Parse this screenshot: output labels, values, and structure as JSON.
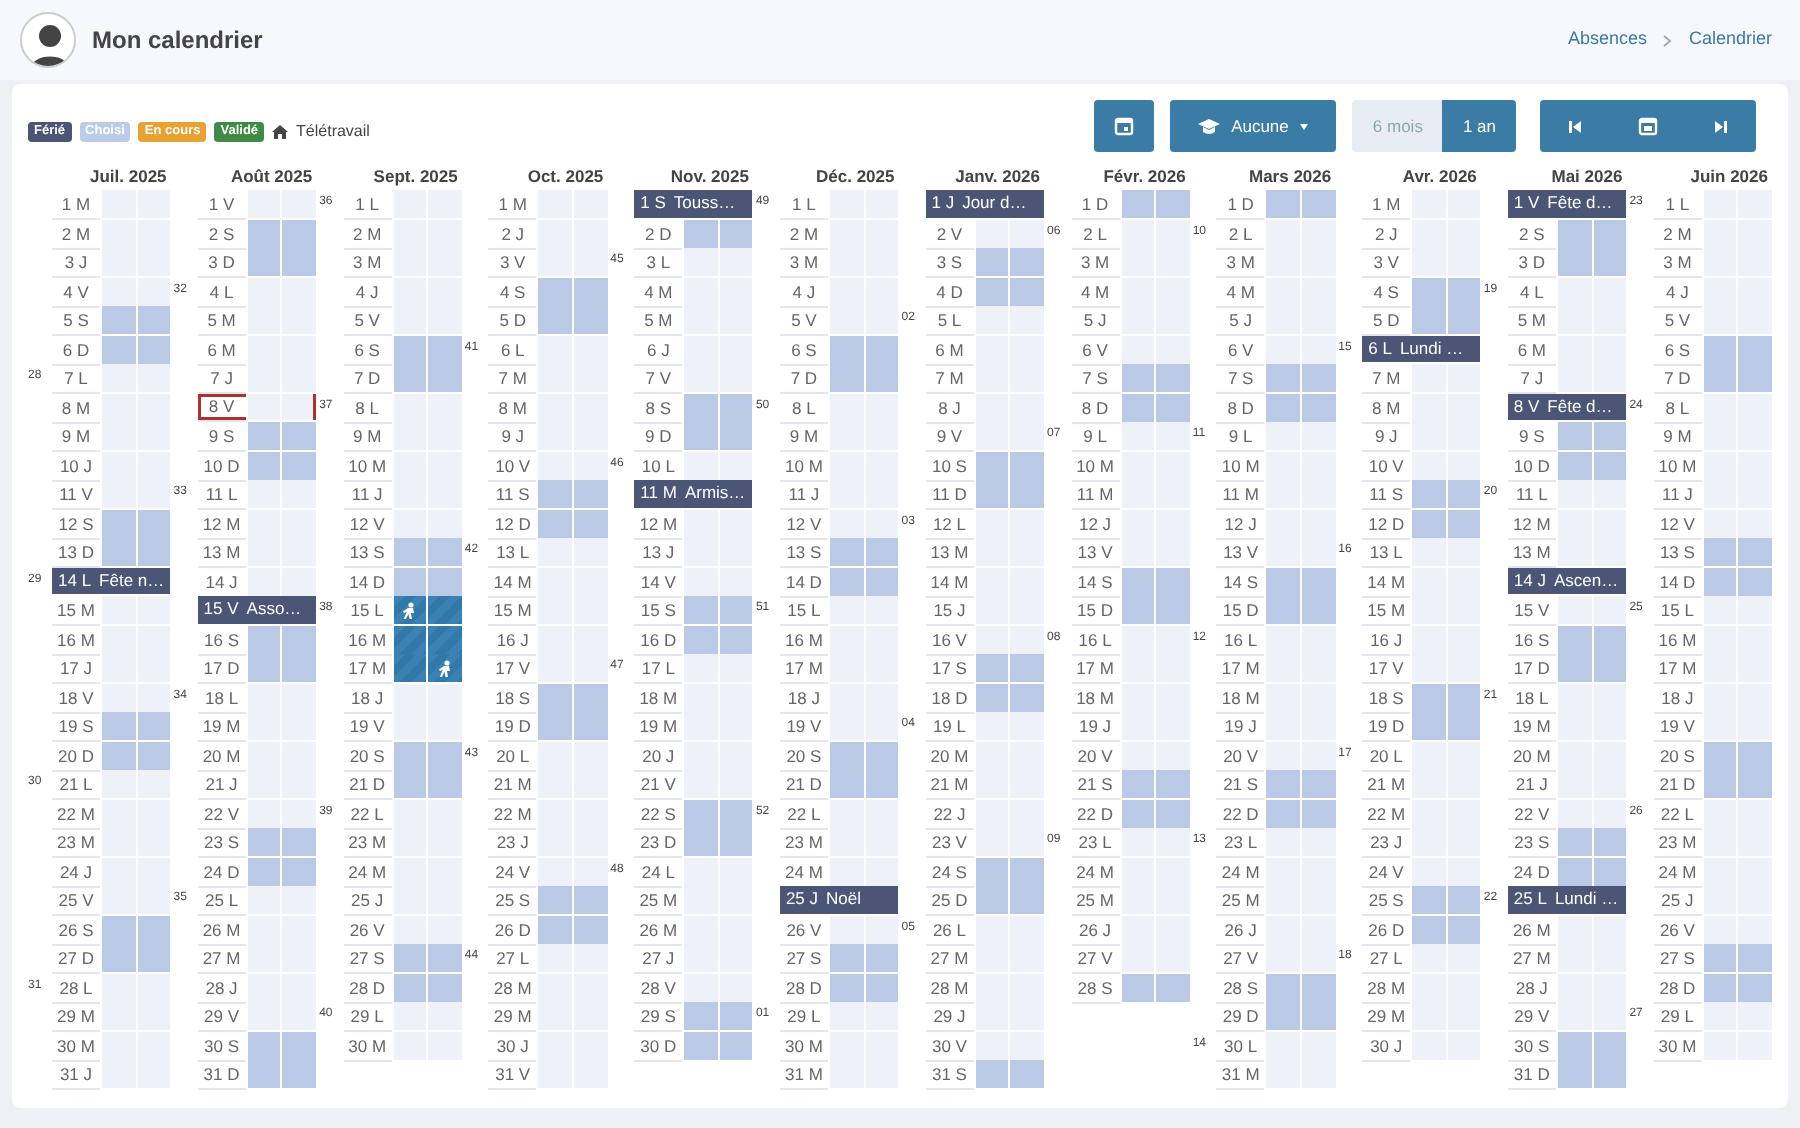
{
  "header": {
    "title": "Mon calendrier",
    "breadcrumb": [
      "Absences",
      "Calendrier"
    ]
  },
  "legend": [
    {
      "label": "Férié",
      "color": "#4b5677"
    },
    {
      "label": "Choisi",
      "color": "#bccbe8"
    },
    {
      "label": "En cours",
      "color": "#e9a132"
    },
    {
      "label": "Validé",
      "color": "#3f8b45"
    }
  ],
  "telework_legend": "Télétravail",
  "toolbar": {
    "type_filter": "Aucune",
    "periods": [
      {
        "label": "6 mois",
        "selected": false
      },
      {
        "label": "1 an",
        "selected": true
      }
    ]
  },
  "months": [
    {
      "title": "Juil. 2025",
      "days": [
        {
          "label": "1 M",
          "kind": "work"
        },
        {
          "label": "2 M",
          "kind": "work"
        },
        {
          "label": "3 J",
          "kind": "work"
        },
        {
          "label": "4 V",
          "kind": "work"
        },
        {
          "label": "5 S",
          "kind": "weekend"
        },
        {
          "label": "6 D",
          "kind": "weekend"
        },
        {
          "label": "7 L",
          "kind": "work",
          "week": "28"
        },
        {
          "label": "8 M",
          "kind": "work"
        },
        {
          "label": "9 M",
          "kind": "work"
        },
        {
          "label": "10 J",
          "kind": "work"
        },
        {
          "label": "11 V",
          "kind": "work"
        },
        {
          "label": "12 S",
          "kind": "weekend"
        },
        {
          "label": "13 D",
          "kind": "weekend"
        },
        {
          "label": "14 L",
          "kind": "holiday",
          "week": "29",
          "holiday": "Fête n…"
        },
        {
          "label": "15 M",
          "kind": "work"
        },
        {
          "label": "16 M",
          "kind": "work"
        },
        {
          "label": "17 J",
          "kind": "work"
        },
        {
          "label": "18 V",
          "kind": "work"
        },
        {
          "label": "19 S",
          "kind": "weekend"
        },
        {
          "label": "20 D",
          "kind": "weekend"
        },
        {
          "label": "21 L",
          "kind": "work",
          "week": "30"
        },
        {
          "label": "22 M",
          "kind": "work"
        },
        {
          "label": "23 M",
          "kind": "work"
        },
        {
          "label": "24 J",
          "kind": "work"
        },
        {
          "label": "25 V",
          "kind": "work"
        },
        {
          "label": "26 S",
          "kind": "weekend"
        },
        {
          "label": "27 D",
          "kind": "weekend"
        },
        {
          "label": "28 L",
          "kind": "work",
          "week": "31"
        },
        {
          "label": "29 M",
          "kind": "work"
        },
        {
          "label": "30 M",
          "kind": "work"
        },
        {
          "label": "31 J",
          "kind": "work"
        }
      ]
    },
    {
      "title": "Août 2025",
      "days": [
        {
          "label": "1 V",
          "kind": "work"
        },
        {
          "label": "2 S",
          "kind": "weekend"
        },
        {
          "label": "3 D",
          "kind": "weekend"
        },
        {
          "label": "4 L",
          "kind": "work",
          "week": "32"
        },
        {
          "label": "5 M",
          "kind": "work"
        },
        {
          "label": "6 M",
          "kind": "work"
        },
        {
          "label": "7 J",
          "kind": "work"
        },
        {
          "label": "8 V",
          "kind": "today"
        },
        {
          "label": "9 S",
          "kind": "weekend"
        },
        {
          "label": "10 D",
          "kind": "weekend"
        },
        {
          "label": "11 L",
          "kind": "work",
          "week": "33"
        },
        {
          "label": "12 M",
          "kind": "work"
        },
        {
          "label": "13 M",
          "kind": "work"
        },
        {
          "label": "14 J",
          "kind": "work"
        },
        {
          "label": "15 V",
          "kind": "holiday",
          "holiday": "Asso…"
        },
        {
          "label": "16 S",
          "kind": "weekend"
        },
        {
          "label": "17 D",
          "kind": "weekend"
        },
        {
          "label": "18 L",
          "kind": "work",
          "week": "34"
        },
        {
          "label": "19 M",
          "kind": "work"
        },
        {
          "label": "20 M",
          "kind": "work"
        },
        {
          "label": "21 J",
          "kind": "work"
        },
        {
          "label": "22 V",
          "kind": "work"
        },
        {
          "label": "23 S",
          "kind": "weekend"
        },
        {
          "label": "24 D",
          "kind": "weekend"
        },
        {
          "label": "25 L",
          "kind": "work",
          "week": "35"
        },
        {
          "label": "26 M",
          "kind": "work"
        },
        {
          "label": "27 M",
          "kind": "work"
        },
        {
          "label": "28 J",
          "kind": "work"
        },
        {
          "label": "29 V",
          "kind": "work"
        },
        {
          "label": "30 S",
          "kind": "weekend"
        },
        {
          "label": "31 D",
          "kind": "weekend"
        }
      ]
    },
    {
      "title": "Sept. 2025",
      "days": [
        {
          "label": "1 L",
          "kind": "work",
          "week": "36"
        },
        {
          "label": "2 M",
          "kind": "work"
        },
        {
          "label": "3 M",
          "kind": "work"
        },
        {
          "label": "4 J",
          "kind": "work"
        },
        {
          "label": "5 V",
          "kind": "work"
        },
        {
          "label": "6 S",
          "kind": "weekend"
        },
        {
          "label": "7 D",
          "kind": "weekend"
        },
        {
          "label": "8 L",
          "kind": "work",
          "week": "37"
        },
        {
          "label": "9 M",
          "kind": "work"
        },
        {
          "label": "10 M",
          "kind": "work"
        },
        {
          "label": "11 J",
          "kind": "work"
        },
        {
          "label": "12 V",
          "kind": "work"
        },
        {
          "label": "13 S",
          "kind": "weekend"
        },
        {
          "label": "14 D",
          "kind": "weekend"
        },
        {
          "label": "15 L",
          "kind": "selstart",
          "week": "38"
        },
        {
          "label": "16 M",
          "kind": "selected"
        },
        {
          "label": "17 M",
          "kind": "selend"
        },
        {
          "label": "18 J",
          "kind": "work"
        },
        {
          "label": "19 V",
          "kind": "work"
        },
        {
          "label": "20 S",
          "kind": "weekend"
        },
        {
          "label": "21 D",
          "kind": "weekend"
        },
        {
          "label": "22 L",
          "kind": "work",
          "week": "39"
        },
        {
          "label": "23 M",
          "kind": "work"
        },
        {
          "label": "24 M",
          "kind": "work"
        },
        {
          "label": "25 J",
          "kind": "work"
        },
        {
          "label": "26 V",
          "kind": "work"
        },
        {
          "label": "27 S",
          "kind": "weekend"
        },
        {
          "label": "28 D",
          "kind": "weekend"
        },
        {
          "label": "29 L",
          "kind": "work",
          "week": "40"
        },
        {
          "label": "30 M",
          "kind": "work"
        }
      ]
    },
    {
      "title": "Oct. 2025",
      "days": [
        {
          "label": "1 M",
          "kind": "work"
        },
        {
          "label": "2 J",
          "kind": "work"
        },
        {
          "label": "3 V",
          "kind": "work"
        },
        {
          "label": "4 S",
          "kind": "weekend"
        },
        {
          "label": "5 D",
          "kind": "weekend"
        },
        {
          "label": "6 L",
          "kind": "work",
          "week": "41"
        },
        {
          "label": "7 M",
          "kind": "work"
        },
        {
          "label": "8 M",
          "kind": "work"
        },
        {
          "label": "9 J",
          "kind": "work"
        },
        {
          "label": "10 V",
          "kind": "work"
        },
        {
          "label": "11 S",
          "kind": "weekend"
        },
        {
          "label": "12 D",
          "kind": "weekend"
        },
        {
          "label": "13 L",
          "kind": "work",
          "week": "42"
        },
        {
          "label": "14 M",
          "kind": "work"
        },
        {
          "label": "15 M",
          "kind": "work"
        },
        {
          "label": "16 J",
          "kind": "work"
        },
        {
          "label": "17 V",
          "kind": "work"
        },
        {
          "label": "18 S",
          "kind": "weekend"
        },
        {
          "label": "19 D",
          "kind": "weekend"
        },
        {
          "label": "20 L",
          "kind": "work",
          "week": "43"
        },
        {
          "label": "21 M",
          "kind": "work"
        },
        {
          "label": "22 M",
          "kind": "work"
        },
        {
          "label": "23 J",
          "kind": "work"
        },
        {
          "label": "24 V",
          "kind": "work"
        },
        {
          "label": "25 S",
          "kind": "weekend"
        },
        {
          "label": "26 D",
          "kind": "weekend"
        },
        {
          "label": "27 L",
          "kind": "work",
          "week": "44"
        },
        {
          "label": "28 M",
          "kind": "work"
        },
        {
          "label": "29 M",
          "kind": "work"
        },
        {
          "label": "30 J",
          "kind": "work"
        },
        {
          "label": "31 V",
          "kind": "work"
        }
      ]
    },
    {
      "title": "Nov. 2025",
      "days": [
        {
          "label": "1 S",
          "kind": "holiday",
          "holiday": "Touss…"
        },
        {
          "label": "2 D",
          "kind": "weekend"
        },
        {
          "label": "3 L",
          "kind": "work",
          "week": "45"
        },
        {
          "label": "4 M",
          "kind": "work"
        },
        {
          "label": "5 M",
          "kind": "work"
        },
        {
          "label": "6 J",
          "kind": "work"
        },
        {
          "label": "7 V",
          "kind": "work"
        },
        {
          "label": "8 S",
          "kind": "weekend"
        },
        {
          "label": "9 D",
          "kind": "weekend"
        },
        {
          "label": "10 L",
          "kind": "work",
          "week": "46"
        },
        {
          "label": "11 M",
          "kind": "holiday",
          "holiday": "Armis…"
        },
        {
          "label": "12 M",
          "kind": "work"
        },
        {
          "label": "13 J",
          "kind": "work"
        },
        {
          "label": "14 V",
          "kind": "work"
        },
        {
          "label": "15 S",
          "kind": "weekend"
        },
        {
          "label": "16 D",
          "kind": "weekend"
        },
        {
          "label": "17 L",
          "kind": "work",
          "week": "47"
        },
        {
          "label": "18 M",
          "kind": "work"
        },
        {
          "label": "19 M",
          "kind": "work"
        },
        {
          "label": "20 J",
          "kind": "work"
        },
        {
          "label": "21 V",
          "kind": "work"
        },
        {
          "label": "22 S",
          "kind": "weekend"
        },
        {
          "label": "23 D",
          "kind": "weekend"
        },
        {
          "label": "24 L",
          "kind": "work",
          "week": "48"
        },
        {
          "label": "25 M",
          "kind": "work"
        },
        {
          "label": "26 M",
          "kind": "work"
        },
        {
          "label": "27 J",
          "kind": "work"
        },
        {
          "label": "28 V",
          "kind": "work"
        },
        {
          "label": "29 S",
          "kind": "weekend"
        },
        {
          "label": "30 D",
          "kind": "weekend"
        }
      ]
    },
    {
      "title": "Déc. 2025",
      "days": [
        {
          "label": "1 L",
          "kind": "work",
          "week": "49"
        },
        {
          "label": "2 M",
          "kind": "work"
        },
        {
          "label": "3 M",
          "kind": "work"
        },
        {
          "label": "4 J",
          "kind": "work"
        },
        {
          "label": "5 V",
          "kind": "work"
        },
        {
          "label": "6 S",
          "kind": "weekend"
        },
        {
          "label": "7 D",
          "kind": "weekend"
        },
        {
          "label": "8 L",
          "kind": "work",
          "week": "50"
        },
        {
          "label": "9 M",
          "kind": "work"
        },
        {
          "label": "10 M",
          "kind": "work"
        },
        {
          "label": "11 J",
          "kind": "work"
        },
        {
          "label": "12 V",
          "kind": "work"
        },
        {
          "label": "13 S",
          "kind": "weekend"
        },
        {
          "label": "14 D",
          "kind": "weekend"
        },
        {
          "label": "15 L",
          "kind": "work",
          "week": "51"
        },
        {
          "label": "16 M",
          "kind": "work"
        },
        {
          "label": "17 M",
          "kind": "work"
        },
        {
          "label": "18 J",
          "kind": "work"
        },
        {
          "label": "19 V",
          "kind": "work"
        },
        {
          "label": "20 S",
          "kind": "weekend"
        },
        {
          "label": "21 D",
          "kind": "weekend"
        },
        {
          "label": "22 L",
          "kind": "work",
          "week": "52"
        },
        {
          "label": "23 M",
          "kind": "work"
        },
        {
          "label": "24 M",
          "kind": "work"
        },
        {
          "label": "25 J",
          "kind": "holiday",
          "holiday": "Noël"
        },
        {
          "label": "26 V",
          "kind": "work"
        },
        {
          "label": "27 S",
          "kind": "weekend"
        },
        {
          "label": "28 D",
          "kind": "weekend"
        },
        {
          "label": "29 L",
          "kind": "work",
          "week": "01"
        },
        {
          "label": "30 M",
          "kind": "work"
        },
        {
          "label": "31 M",
          "kind": "work"
        }
      ]
    },
    {
      "title": "Janv. 2026",
      "days": [
        {
          "label": "1 J",
          "kind": "holiday",
          "holiday": "Jour d…"
        },
        {
          "label": "2 V",
          "kind": "work"
        },
        {
          "label": "3 S",
          "kind": "weekend"
        },
        {
          "label": "4 D",
          "kind": "weekend"
        },
        {
          "label": "5 L",
          "kind": "work",
          "week": "02"
        },
        {
          "label": "6 M",
          "kind": "work"
        },
        {
          "label": "7 M",
          "kind": "work"
        },
        {
          "label": "8 J",
          "kind": "work"
        },
        {
          "label": "9 V",
          "kind": "work"
        },
        {
          "label": "10 S",
          "kind": "weekend"
        },
        {
          "label": "11 D",
          "kind": "weekend"
        },
        {
          "label": "12 L",
          "kind": "work",
          "week": "03"
        },
        {
          "label": "13 M",
          "kind": "work"
        },
        {
          "label": "14 M",
          "kind": "work"
        },
        {
          "label": "15 J",
          "kind": "work"
        },
        {
          "label": "16 V",
          "kind": "work"
        },
        {
          "label": "17 S",
          "kind": "weekend"
        },
        {
          "label": "18 D",
          "kind": "weekend"
        },
        {
          "label": "19 L",
          "kind": "work",
          "week": "04"
        },
        {
          "label": "20 M",
          "kind": "work"
        },
        {
          "label": "21 M",
          "kind": "work"
        },
        {
          "label": "22 J",
          "kind": "work"
        },
        {
          "label": "23 V",
          "kind": "work"
        },
        {
          "label": "24 S",
          "kind": "weekend"
        },
        {
          "label": "25 D",
          "kind": "weekend"
        },
        {
          "label": "26 L",
          "kind": "work",
          "week": "05"
        },
        {
          "label": "27 M",
          "kind": "work"
        },
        {
          "label": "28 M",
          "kind": "work"
        },
        {
          "label": "29 J",
          "kind": "work"
        },
        {
          "label": "30 V",
          "kind": "work"
        },
        {
          "label": "31 S",
          "kind": "weekend"
        }
      ]
    },
    {
      "title": "Févr. 2026",
      "days": [
        {
          "label": "1 D",
          "kind": "weekend"
        },
        {
          "label": "2 L",
          "kind": "work",
          "week": "06"
        },
        {
          "label": "3 M",
          "kind": "work"
        },
        {
          "label": "4 M",
          "kind": "work"
        },
        {
          "label": "5 J",
          "kind": "work"
        },
        {
          "label": "6 V",
          "kind": "work"
        },
        {
          "label": "7 S",
          "kind": "weekend"
        },
        {
          "label": "8 D",
          "kind": "weekend"
        },
        {
          "label": "9 L",
          "kind": "work",
          "week": "07"
        },
        {
          "label": "10 M",
          "kind": "work"
        },
        {
          "label": "11 M",
          "kind": "work"
        },
        {
          "label": "12 J",
          "kind": "work"
        },
        {
          "label": "13 V",
          "kind": "work"
        },
        {
          "label": "14 S",
          "kind": "weekend"
        },
        {
          "label": "15 D",
          "kind": "weekend"
        },
        {
          "label": "16 L",
          "kind": "work",
          "week": "08"
        },
        {
          "label": "17 M",
          "kind": "work"
        },
        {
          "label": "18 M",
          "kind": "work"
        },
        {
          "label": "19 J",
          "kind": "work"
        },
        {
          "label": "20 V",
          "kind": "work"
        },
        {
          "label": "21 S",
          "kind": "weekend"
        },
        {
          "label": "22 D",
          "kind": "weekend"
        },
        {
          "label": "23 L",
          "kind": "work",
          "week": "09"
        },
        {
          "label": "24 M",
          "kind": "work"
        },
        {
          "label": "25 M",
          "kind": "work"
        },
        {
          "label": "26 J",
          "kind": "work"
        },
        {
          "label": "27 V",
          "kind": "work"
        },
        {
          "label": "28 S",
          "kind": "weekend"
        }
      ]
    },
    {
      "title": "Mars 2026",
      "days": [
        {
          "label": "1 D",
          "kind": "weekend"
        },
        {
          "label": "2 L",
          "kind": "work",
          "week": "10"
        },
        {
          "label": "3 M",
          "kind": "work"
        },
        {
          "label": "4 M",
          "kind": "work"
        },
        {
          "label": "5 J",
          "kind": "work"
        },
        {
          "label": "6 V",
          "kind": "work"
        },
        {
          "label": "7 S",
          "kind": "weekend"
        },
        {
          "label": "8 D",
          "kind": "weekend"
        },
        {
          "label": "9 L",
          "kind": "work",
          "week": "11"
        },
        {
          "label": "10 M",
          "kind": "work"
        },
        {
          "label": "11 M",
          "kind": "work"
        },
        {
          "label": "12 J",
          "kind": "work"
        },
        {
          "label": "13 V",
          "kind": "work"
        },
        {
          "label": "14 S",
          "kind": "weekend"
        },
        {
          "label": "15 D",
          "kind": "weekend"
        },
        {
          "label": "16 L",
          "kind": "work",
          "week": "12"
        },
        {
          "label": "17 M",
          "kind": "work"
        },
        {
          "label": "18 M",
          "kind": "work"
        },
        {
          "label": "19 J",
          "kind": "work"
        },
        {
          "label": "20 V",
          "kind": "work"
        },
        {
          "label": "21 S",
          "kind": "weekend"
        },
        {
          "label": "22 D",
          "kind": "weekend"
        },
        {
          "label": "23 L",
          "kind": "work",
          "week": "13"
        },
        {
          "label": "24 M",
          "kind": "work"
        },
        {
          "label": "25 M",
          "kind": "work"
        },
        {
          "label": "26 J",
          "kind": "work"
        },
        {
          "label": "27 V",
          "kind": "work"
        },
        {
          "label": "28 S",
          "kind": "weekend"
        },
        {
          "label": "29 D",
          "kind": "weekend"
        },
        {
          "label": "30 L",
          "kind": "work",
          "week": "14"
        },
        {
          "label": "31 M",
          "kind": "work"
        }
      ]
    },
    {
      "title": "Avr. 2026",
      "days": [
        {
          "label": "1 M",
          "kind": "work"
        },
        {
          "label": "2 J",
          "kind": "work"
        },
        {
          "label": "3 V",
          "kind": "work"
        },
        {
          "label": "4 S",
          "kind": "weekend"
        },
        {
          "label": "5 D",
          "kind": "weekend"
        },
        {
          "label": "6 L",
          "kind": "holiday",
          "week": "15",
          "holiday": "Lundi …"
        },
        {
          "label": "7 M",
          "kind": "work"
        },
        {
          "label": "8 M",
          "kind": "work"
        },
        {
          "label": "9 J",
          "kind": "work"
        },
        {
          "label": "10 V",
          "kind": "work"
        },
        {
          "label": "11 S",
          "kind": "weekend"
        },
        {
          "label": "12 D",
          "kind": "weekend"
        },
        {
          "label": "13 L",
          "kind": "work",
          "week": "16"
        },
        {
          "label": "14 M",
          "kind": "work"
        },
        {
          "label": "15 M",
          "kind": "work"
        },
        {
          "label": "16 J",
          "kind": "work"
        },
        {
          "label": "17 V",
          "kind": "work"
        },
        {
          "label": "18 S",
          "kind": "weekend"
        },
        {
          "label": "19 D",
          "kind": "weekend"
        },
        {
          "label": "20 L",
          "kind": "work",
          "week": "17"
        },
        {
          "label": "21 M",
          "kind": "work"
        },
        {
          "label": "22 M",
          "kind": "work"
        },
        {
          "label": "23 J",
          "kind": "work"
        },
        {
          "label": "24 V",
          "kind": "work"
        },
        {
          "label": "25 S",
          "kind": "weekend"
        },
        {
          "label": "26 D",
          "kind": "weekend"
        },
        {
          "label": "27 L",
          "kind": "work",
          "week": "18"
        },
        {
          "label": "28 M",
          "kind": "work"
        },
        {
          "label": "29 M",
          "kind": "work"
        },
        {
          "label": "30 J",
          "kind": "work"
        }
      ]
    },
    {
      "title": "Mai 2026",
      "days": [
        {
          "label": "1 V",
          "kind": "holiday",
          "holiday": "Fête d…"
        },
        {
          "label": "2 S",
          "kind": "weekend"
        },
        {
          "label": "3 D",
          "kind": "weekend"
        },
        {
          "label": "4 L",
          "kind": "work",
          "week": "19"
        },
        {
          "label": "5 M",
          "kind": "work"
        },
        {
          "label": "6 M",
          "kind": "work"
        },
        {
          "label": "7 J",
          "kind": "work"
        },
        {
          "label": "8 V",
          "kind": "holiday",
          "holiday": "Fête d…"
        },
        {
          "label": "9 S",
          "kind": "weekend"
        },
        {
          "label": "10 D",
          "kind": "weekend"
        },
        {
          "label": "11 L",
          "kind": "work",
          "week": "20"
        },
        {
          "label": "12 M",
          "kind": "work"
        },
        {
          "label": "13 M",
          "kind": "work"
        },
        {
          "label": "14 J",
          "kind": "holiday",
          "holiday": "Ascen…"
        },
        {
          "label": "15 V",
          "kind": "work"
        },
        {
          "label": "16 S",
          "kind": "weekend"
        },
        {
          "label": "17 D",
          "kind": "weekend"
        },
        {
          "label": "18 L",
          "kind": "work",
          "week": "21"
        },
        {
          "label": "19 M",
          "kind": "work"
        },
        {
          "label": "20 M",
          "kind": "work"
        },
        {
          "label": "21 J",
          "kind": "work"
        },
        {
          "label": "22 V",
          "kind": "work"
        },
        {
          "label": "23 S",
          "kind": "weekend"
        },
        {
          "label": "24 D",
          "kind": "weekend"
        },
        {
          "label": "25 L",
          "kind": "holiday",
          "week": "22",
          "holiday": "Lundi …"
        },
        {
          "label": "26 M",
          "kind": "work"
        },
        {
          "label": "27 M",
          "kind": "work"
        },
        {
          "label": "28 J",
          "kind": "work"
        },
        {
          "label": "29 V",
          "kind": "work"
        },
        {
          "label": "30 S",
          "kind": "weekend"
        },
        {
          "label": "31 D",
          "kind": "weekend"
        }
      ]
    },
    {
      "title": "Juin 2026",
      "days": [
        {
          "label": "1 L",
          "kind": "work",
          "week": "23"
        },
        {
          "label": "2 M",
          "kind": "work"
        },
        {
          "label": "3 M",
          "kind": "work"
        },
        {
          "label": "4 J",
          "kind": "work"
        },
        {
          "label": "5 V",
          "kind": "work"
        },
        {
          "label": "6 S",
          "kind": "weekend"
        },
        {
          "label": "7 D",
          "kind": "weekend"
        },
        {
          "label": "8 L",
          "kind": "work",
          "week": "24"
        },
        {
          "label": "9 M",
          "kind": "work"
        },
        {
          "label": "10 M",
          "kind": "work"
        },
        {
          "label": "11 J",
          "kind": "work"
        },
        {
          "label": "12 V",
          "kind": "work"
        },
        {
          "label": "13 S",
          "kind": "weekend"
        },
        {
          "label": "14 D",
          "kind": "weekend"
        },
        {
          "label": "15 L",
          "kind": "work",
          "week": "25"
        },
        {
          "label": "16 M",
          "kind": "work"
        },
        {
          "label": "17 M",
          "kind": "work"
        },
        {
          "label": "18 J",
          "kind": "work"
        },
        {
          "label": "19 V",
          "kind": "work"
        },
        {
          "label": "20 S",
          "kind": "weekend"
        },
        {
          "label": "21 D",
          "kind": "weekend"
        },
        {
          "label": "22 L",
          "kind": "work",
          "week": "26"
        },
        {
          "label": "23 M",
          "kind": "work"
        },
        {
          "label": "24 M",
          "kind": "work"
        },
        {
          "label": "25 J",
          "kind": "work"
        },
        {
          "label": "26 V",
          "kind": "work"
        },
        {
          "label": "27 S",
          "kind": "weekend"
        },
        {
          "label": "28 D",
          "kind": "weekend"
        },
        {
          "label": "29 L",
          "kind": "work",
          "week": "27"
        },
        {
          "label": "30 M",
          "kind": "work"
        }
      ]
    }
  ]
}
